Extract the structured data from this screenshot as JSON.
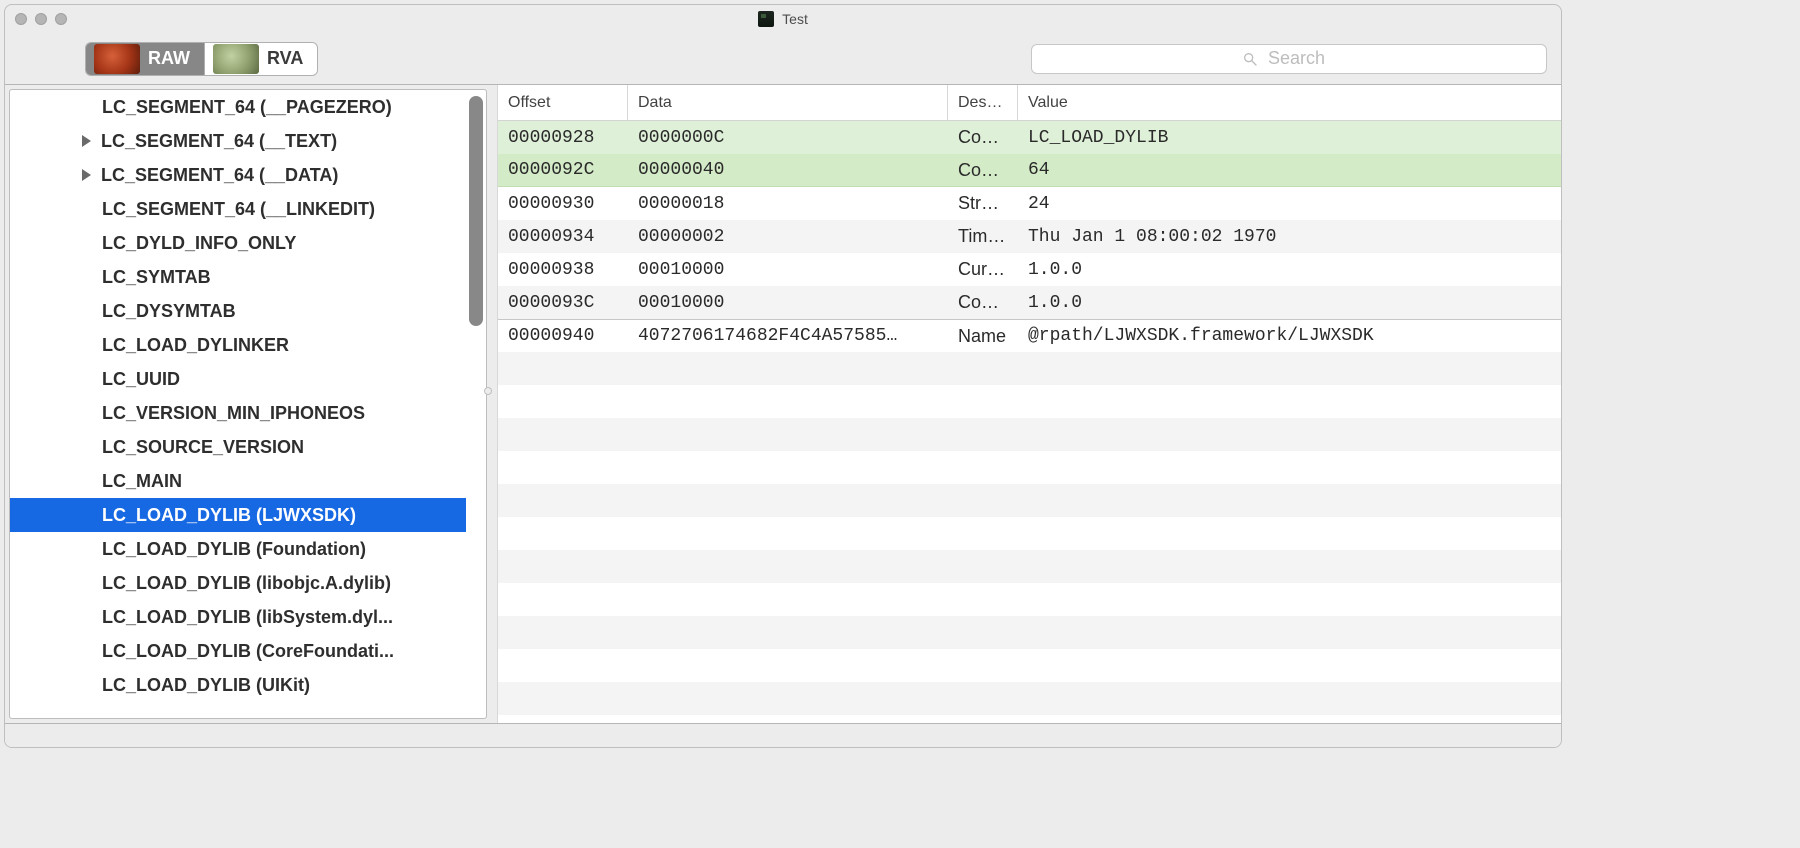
{
  "window": {
    "title": "Test"
  },
  "toolbar": {
    "seg": {
      "raw": "RAW",
      "rva": "RVA"
    },
    "search_placeholder": "Search"
  },
  "tree": {
    "items": [
      {
        "label": "LC_SEGMENT_64 (__PAGEZERO)",
        "has_arrow": false,
        "selected": false
      },
      {
        "label": "LC_SEGMENT_64 (__TEXT)",
        "has_arrow": true,
        "selected": false
      },
      {
        "label": "LC_SEGMENT_64 (__DATA)",
        "has_arrow": true,
        "selected": false
      },
      {
        "label": "LC_SEGMENT_64 (__LINKEDIT)",
        "has_arrow": false,
        "selected": false
      },
      {
        "label": "LC_DYLD_INFO_ONLY",
        "has_arrow": false,
        "selected": false
      },
      {
        "label": "LC_SYMTAB",
        "has_arrow": false,
        "selected": false
      },
      {
        "label": "LC_DYSYMTAB",
        "has_arrow": false,
        "selected": false
      },
      {
        "label": "LC_LOAD_DYLINKER",
        "has_arrow": false,
        "selected": false
      },
      {
        "label": "LC_UUID",
        "has_arrow": false,
        "selected": false
      },
      {
        "label": "LC_VERSION_MIN_IPHONEOS",
        "has_arrow": false,
        "selected": false
      },
      {
        "label": "LC_SOURCE_VERSION",
        "has_arrow": false,
        "selected": false
      },
      {
        "label": "LC_MAIN",
        "has_arrow": false,
        "selected": false
      },
      {
        "label": "LC_LOAD_DYLIB (LJWXSDK)",
        "has_arrow": false,
        "selected": true
      },
      {
        "label": "LC_LOAD_DYLIB (Foundation)",
        "has_arrow": false,
        "selected": false
      },
      {
        "label": "LC_LOAD_DYLIB (libobjc.A.dylib)",
        "has_arrow": false,
        "selected": false
      },
      {
        "label": "LC_LOAD_DYLIB (libSystem.dyl...",
        "has_arrow": false,
        "selected": false
      },
      {
        "label": "LC_LOAD_DYLIB (CoreFoundati...",
        "has_arrow": false,
        "selected": false
      },
      {
        "label": "LC_LOAD_DYLIB (UIKit)",
        "has_arrow": false,
        "selected": false
      }
    ]
  },
  "table": {
    "headers": {
      "offset": "Offset",
      "data": "Data",
      "desc": "Des…",
      "value": "Value"
    },
    "rows": [
      {
        "offset": "00000928",
        "data": "0000000C",
        "desc": "Com…",
        "value": "LC_LOAD_DYLIB",
        "cls": "hi"
      },
      {
        "offset": "0000092C",
        "data": "00000040",
        "desc": "Com…",
        "value": "64",
        "cls": "hi2"
      },
      {
        "offset": "00000930",
        "data": "00000018",
        "desc": "Str…",
        "value": "24",
        "cls": ""
      },
      {
        "offset": "00000934",
        "data": "00000002",
        "desc": "Tim…",
        "value": "Thu Jan  1 08:00:02 1970",
        "cls": "alt"
      },
      {
        "offset": "00000938",
        "data": "00010000",
        "desc": "Cur…",
        "value": "1.0.0",
        "cls": ""
      },
      {
        "offset": "0000093C",
        "data": "00010000",
        "desc": "Com…",
        "value": "1.0.0",
        "cls": "alt"
      },
      {
        "offset": "00000940",
        "data": "4072706174682F4C4A57585…",
        "desc": "Name",
        "value": "@rpath/LJWXSDK.framework/LJWXSDK",
        "cls": "sep"
      }
    ]
  }
}
